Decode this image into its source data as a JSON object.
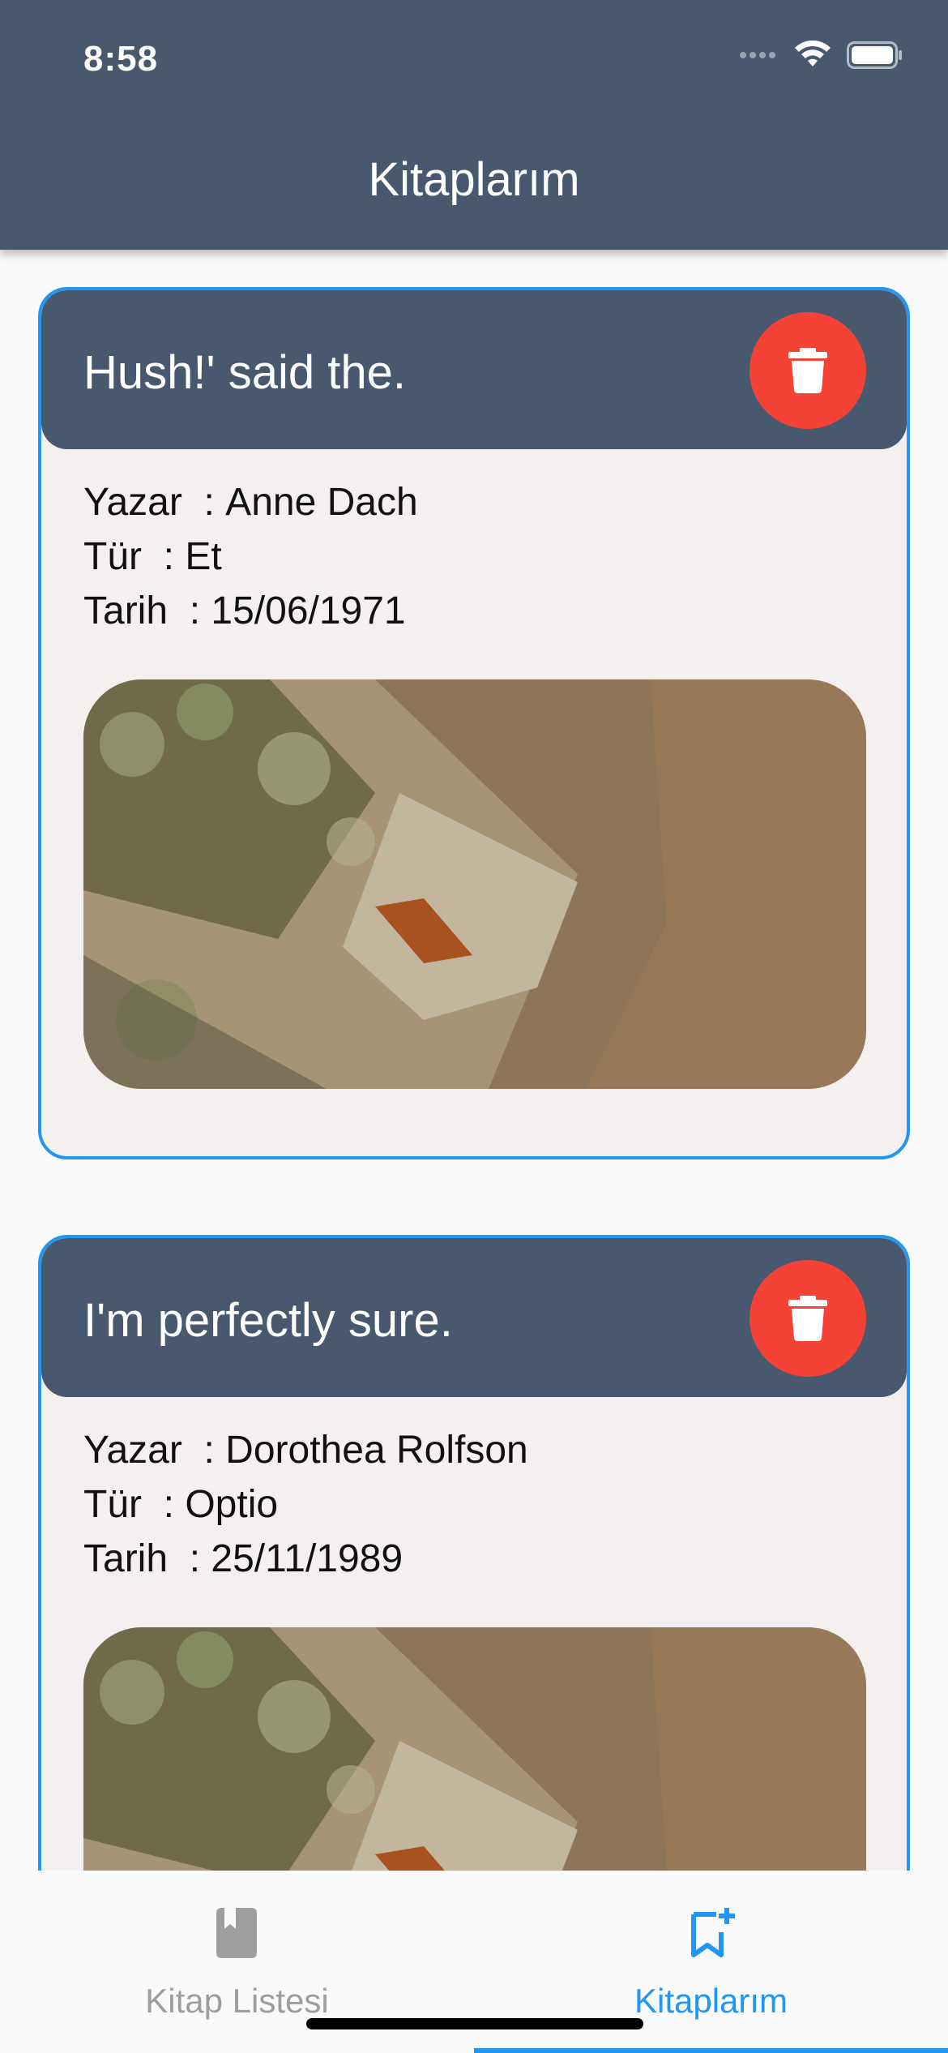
{
  "status_bar": {
    "time": "8:58"
  },
  "header": {
    "title": "Kitaplarım"
  },
  "books": [
    {
      "title": "Hush!' said the.",
      "author_label": "Yazar",
      "author": "Anne Dach",
      "genre_label": "Tür",
      "genre": "Et",
      "date_label": "Tarih",
      "date": "15/06/1971"
    },
    {
      "title": "I'm perfectly sure.",
      "author_label": "Yazar",
      "author": "Dorothea Rolfson",
      "genre_label": "Tür",
      "genre": "Optio",
      "date_label": "Tarih",
      "date": "25/11/1989"
    }
  ],
  "bottom_nav": {
    "items": [
      {
        "label": "Kitap Listesi",
        "icon": "book-icon",
        "active": false
      },
      {
        "label": "Kitaplarım",
        "icon": "bookmark-add-icon",
        "active": true
      }
    ]
  },
  "colors": {
    "app_bar": "#48596f",
    "card_border": "#2196f3",
    "card_bg": "#f4f0ef",
    "delete": "#f44336",
    "active_nav": "#2196f3",
    "inactive_nav": "#9e9e9e"
  }
}
